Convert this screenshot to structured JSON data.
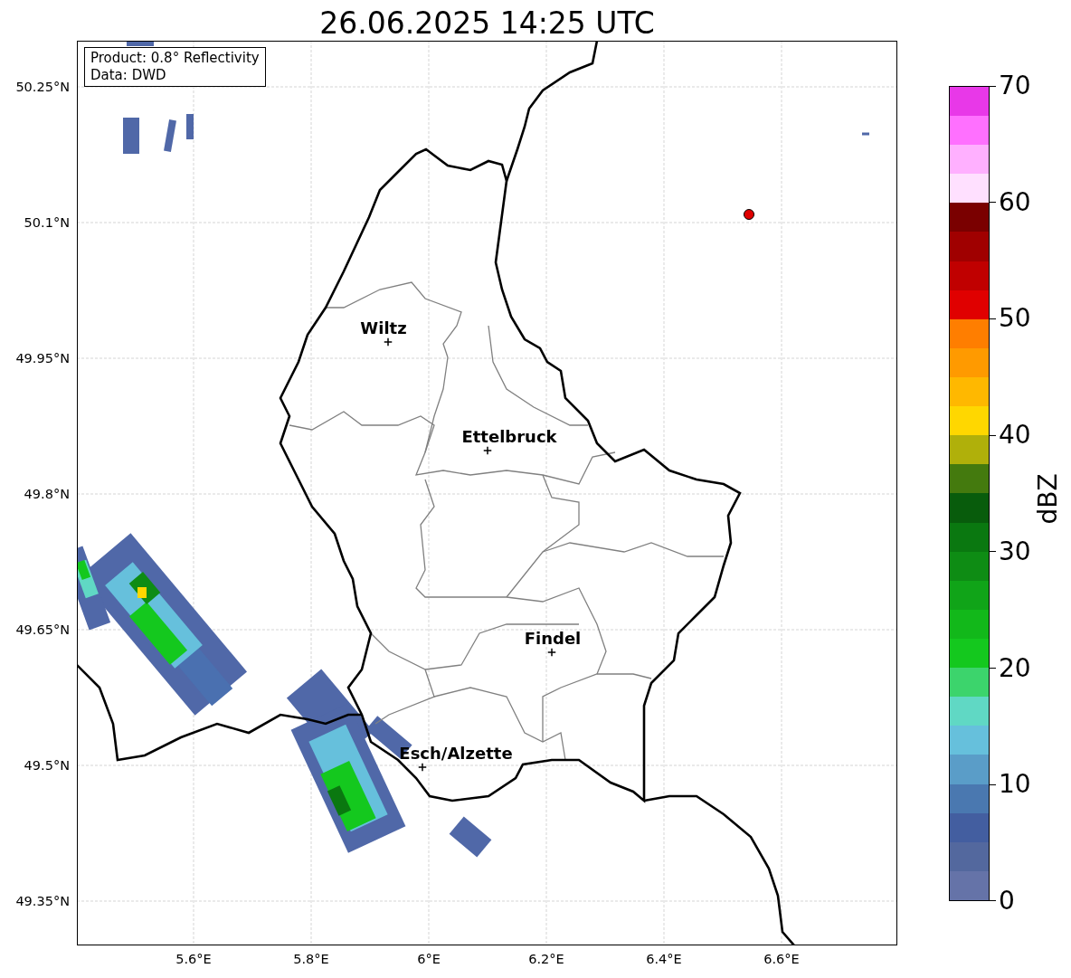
{
  "title": "26.06.2025 14:25 UTC",
  "info_box": {
    "lines": [
      "Product: 0.8° Reflectivity",
      "Data: DWD"
    ]
  },
  "y_ticks": [
    "50.25°N",
    "50.1°N",
    "49.95°N",
    "49.8°N",
    "49.65°N",
    "49.5°N",
    "49.35°N"
  ],
  "x_ticks": [
    "5.6°E",
    "5.8°E",
    "6°E",
    "6.2°E",
    "6.4°E",
    "6.6°E"
  ],
  "cities": [
    {
      "name": "Wiltz"
    },
    {
      "name": "Ettelbruck"
    },
    {
      "name": "Findel"
    },
    {
      "name": "Esch/Alzette"
    }
  ],
  "colorbar": {
    "label": "dBZ",
    "ticks": [
      "70",
      "60",
      "50",
      "40",
      "30",
      "20",
      "10",
      "0"
    ],
    "bins": [
      {
        "color": "#6573a8"
      },
      {
        "color": "#53689e"
      },
      {
        "color": "#435ea0"
      },
      {
        "color": "#4a78b0"
      },
      {
        "color": "#5a9dc8"
      },
      {
        "color": "#66c0dc"
      },
      {
        "color": "#60d8c4"
      },
      {
        "color": "#3cd46c"
      },
      {
        "color": "#14c81e"
      },
      {
        "color": "#12b81a"
      },
      {
        "color": "#10a418"
      },
      {
        "color": "#0e8c14"
      },
      {
        "color": "#0a7810"
      },
      {
        "color": "#085c0c"
      },
      {
        "color": "#447a0e"
      },
      {
        "color": "#b0b00a"
      },
      {
        "color": "#ffd700"
      },
      {
        "color": "#ffb800"
      },
      {
        "color": "#ff9a00"
      },
      {
        "color": "#ff7e00"
      },
      {
        "color": "#e00000"
      },
      {
        "color": "#c00000"
      },
      {
        "color": "#a00000"
      },
      {
        "color": "#7a0000"
      },
      {
        "color": "#ffe0ff"
      },
      {
        "color": "#ffb0ff"
      },
      {
        "color": "#ff70ff"
      },
      {
        "color": "#e838e8"
      }
    ]
  }
}
